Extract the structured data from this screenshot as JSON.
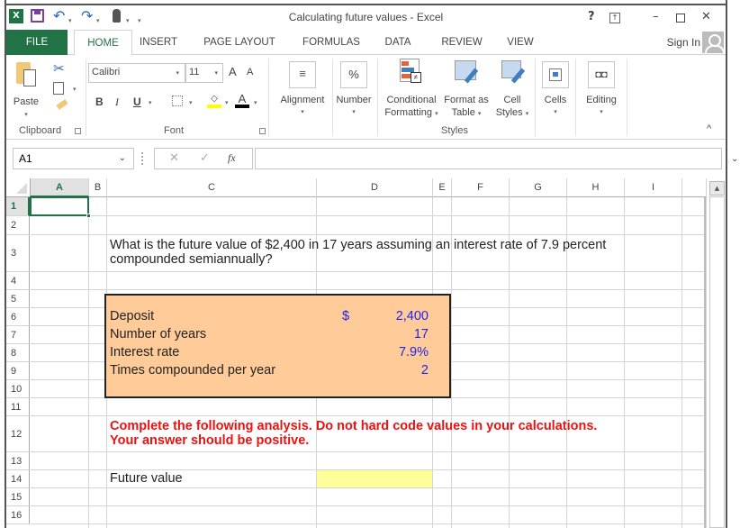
{
  "window": {
    "title": "Calculating future values - Excel",
    "help": "?",
    "ribbon_display": "⧈",
    "minimize": "–",
    "restore": "🗗",
    "close": "✕"
  },
  "quick_access": {
    "app_icon": "X",
    "save": "save-icon",
    "undo": "↶",
    "redo": "↷",
    "touch": "touch-mode-icon",
    "customize": "▾"
  },
  "tabs": [
    {
      "label": "FILE"
    },
    {
      "label": "HOME"
    },
    {
      "label": "INSERT"
    },
    {
      "label": "PAGE LAYOUT"
    },
    {
      "label": "FORMULAS"
    },
    {
      "label": "DATA"
    },
    {
      "label": "REVIEW"
    },
    {
      "label": "VIEW"
    }
  ],
  "sign_in": "Sign In",
  "ribbon": {
    "clipboard": {
      "paste": "Paste",
      "group": "Clipboard"
    },
    "font": {
      "name": "Calibri",
      "size": "11",
      "bold": "B",
      "italic": "I",
      "underline": "U",
      "grow": "A",
      "shrink": "A",
      "font_color": "A",
      "group": "Font"
    },
    "alignment": {
      "label": "Alignment"
    },
    "number": {
      "label": "Number",
      "symbol": "%"
    },
    "styles": {
      "conditional_1": "Conditional",
      "conditional_2": "Formatting",
      "format_table_1": "Format as",
      "format_table_2": "Table",
      "cell_styles_1": "Cell",
      "cell_styles_2": "Styles",
      "group": "Styles"
    },
    "cells": {
      "label": "Cells"
    },
    "editing": {
      "label": "Editing"
    },
    "collapse": "^"
  },
  "formula_bar": {
    "name_box": "A1",
    "cancel": "✕",
    "enter": "✓",
    "fx": "fx",
    "formula": ""
  },
  "sheet": {
    "columns": [
      "A",
      "B",
      "C",
      "D",
      "E",
      "F",
      "G",
      "H",
      "I"
    ],
    "rows": [
      "1",
      "2",
      "3",
      "4",
      "5",
      "6",
      "7",
      "8",
      "9",
      "10",
      "11",
      "12",
      "13",
      "14",
      "15",
      "16"
    ],
    "question_line1": "What is the future value of $2,400 in 17 years assuming an interest rate of 7.9 percent",
    "question_line2": "compounded semiannually?",
    "inputs": [
      {
        "label": "Deposit",
        "currency": "$",
        "value": "2,400"
      },
      {
        "label": "Number of years",
        "currency": "",
        "value": "17"
      },
      {
        "label": "Interest rate",
        "currency": "",
        "value": "7.9%"
      },
      {
        "label": "Times compounded per year",
        "currency": "",
        "value": "2"
      }
    ],
    "instruction_line1": "Complete the following analysis. Do not hard code values in your calculations.",
    "instruction_line2": "Your answer should be positive.",
    "output_label": "Future value",
    "output_value": ""
  },
  "colors": {
    "excel_green": "#217346",
    "input_box_fill": "#ffcc99",
    "input_value_blue": "#2222ee",
    "instruction_red": "#ee1111",
    "answer_cell_fill": "#ffff99"
  }
}
